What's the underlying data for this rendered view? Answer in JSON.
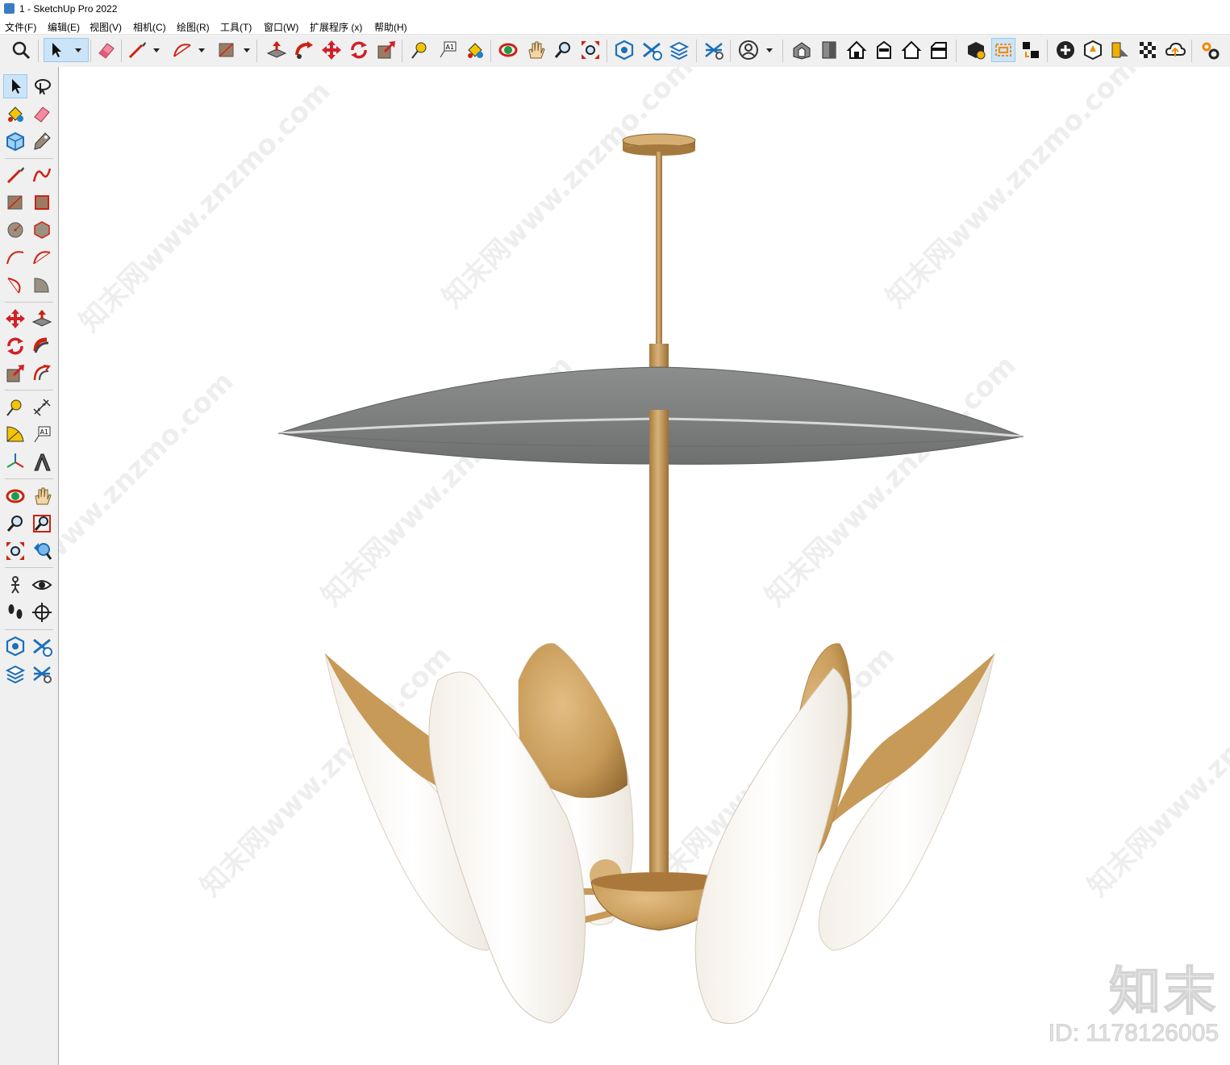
{
  "window": {
    "title": "1 - SketchUp Pro 2022"
  },
  "menu": {
    "file": "文件(F)",
    "edit": "编辑(E)",
    "view": "视图(V)",
    "camera": "相机(C)",
    "draw": "绘图(R)",
    "tools": "工具(T)",
    "window": "窗口(W)",
    "extensions": "扩展程序 (x)",
    "help": "帮助(H)"
  },
  "toolbar": {
    "text_tool_glyph": "A1"
  },
  "left_toolbar": {
    "text_tool_glyph": "A1"
  },
  "watermark": {
    "logo": "知末",
    "id": "ID: 1178126005",
    "repeating": "知末网www.znzmo.com"
  },
  "colors": {
    "toolbar_bg": "#f0f0f0",
    "active_tool": "#cce4f7",
    "shade_gray": "#7d7f7f",
    "brass": "#c79a57",
    "shell_white": "#f8f4ee"
  }
}
